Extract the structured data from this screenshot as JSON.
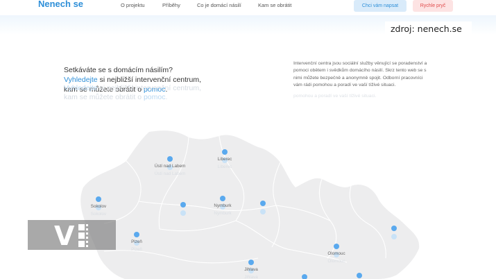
{
  "header": {
    "logo": "Nenech se",
    "nav": [
      "O projektu",
      "Příběhy",
      "Co je domácí násilí",
      "Kam se obrátit"
    ],
    "cta_write": "Chci vám napsat",
    "cta_leave": "Rychle pryč"
  },
  "source_caption": "zdroj: nenech.se",
  "hero": {
    "line1": "Setkáváte se s domácím násilím?",
    "line2_link": "Vyhledejte",
    "line2_rest": " si nejbližší intervenční centrum,",
    "line3_start": "kam se můžete obrátit o ",
    "line3_link": "pomoc",
    "line3_end": "."
  },
  "description": "Intervenční centra jsou sociální služby věnující se poradenství a pomoci obětem i svědkům domácího násilí. Skrz tento web se s nimi můžete bezpečně a anonymně spojit. Odborní pracovníci vám rádi pomohou a poradí ve vaší tíživé situaci.",
  "map": {
    "cities": [
      {
        "name": "Liberec"
      },
      {
        "name": "Ústí nad Labem"
      },
      {
        "name": "Nymburk"
      },
      {
        "name": "Sokolov"
      },
      {
        "name": "Plzeň"
      },
      {
        "name": "Olomouc"
      },
      {
        "name": "Jihlava"
      },
      {
        "name": ""
      },
      {
        "name": ""
      },
      {
        "name": ""
      },
      {
        "name": ""
      },
      {
        "name": ""
      }
    ]
  },
  "watermark": "V",
  "colors": {
    "accent": "#2e8fd8",
    "danger": "#e04b4b",
    "map_fill": "#ededee",
    "pin": "#5aa9ee"
  }
}
